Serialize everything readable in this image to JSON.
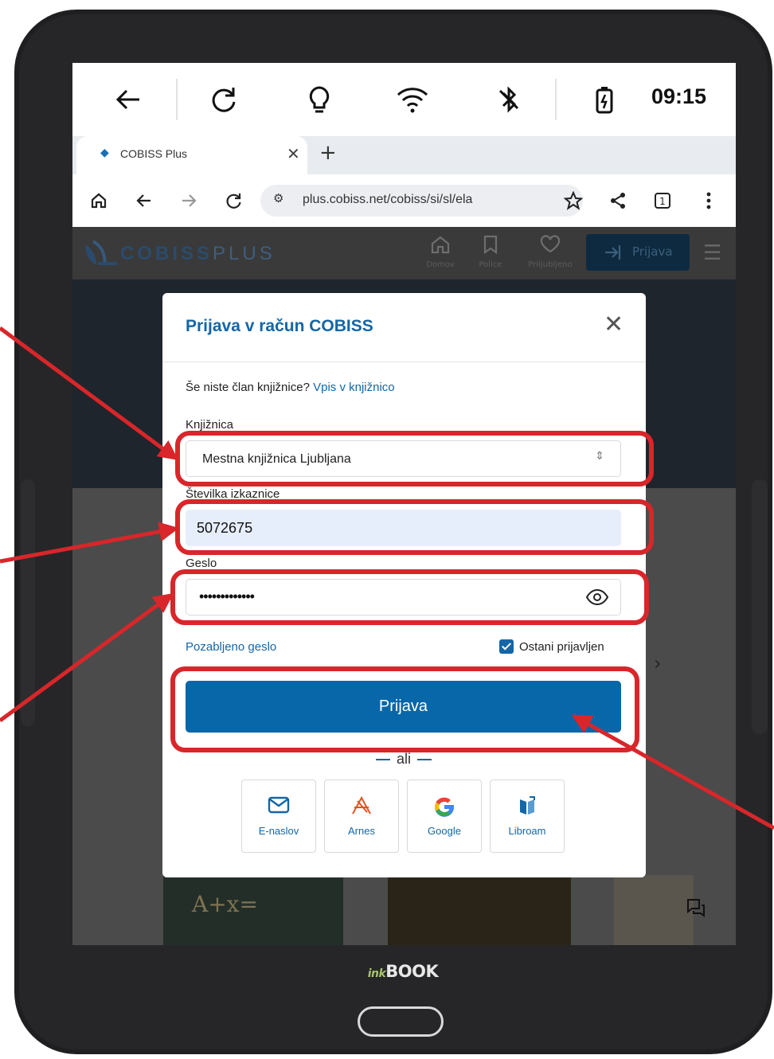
{
  "device": {
    "brand_prefix": "ink",
    "brand_name": "BOOK"
  },
  "status_bar": {
    "time": "09:15",
    "icons": [
      "back-arrow-icon",
      "refresh-icon",
      "lightbulb-icon",
      "wifi-icon",
      "bluetooth-off-icon",
      "battery-icon"
    ]
  },
  "browser": {
    "tab": {
      "title": "COBISS Plus"
    },
    "url": "plus.cobiss.net/cobiss/si/sl/ela",
    "tabs_count": "1"
  },
  "site": {
    "logo_main": "COBISS",
    "logo_sub": "PLUS",
    "nav": [
      {
        "label": "Domov"
      },
      {
        "label": "Police"
      },
      {
        "label": "Priljubljeno"
      }
    ],
    "login_label": "Prijava"
  },
  "modal": {
    "title": "Prijava v račun COBISS",
    "signup_prompt": "Še niste član knjižnice?",
    "signup_link": "Vpis v knjižnico",
    "library_label": "Knjižnica",
    "library_value": "Mestna knjižnica Ljubljana",
    "card_label": "Številka izkaznice",
    "card_value": "5072675",
    "password_label": "Geslo",
    "password_value": "•••••••••••••",
    "forgot_password": "Pozabljeno geslo",
    "stay_logged_in": "Ostani prijavljen",
    "submit_label": "Prijava",
    "or_label": "ali",
    "providers": [
      {
        "label": "E-naslov"
      },
      {
        "label": "Arnes"
      },
      {
        "label": "Google"
      },
      {
        "label": "Libroam"
      }
    ]
  },
  "colors": {
    "accent": "#1466a6",
    "primary_button": "#0767a8",
    "annotation": "#d8262a"
  }
}
